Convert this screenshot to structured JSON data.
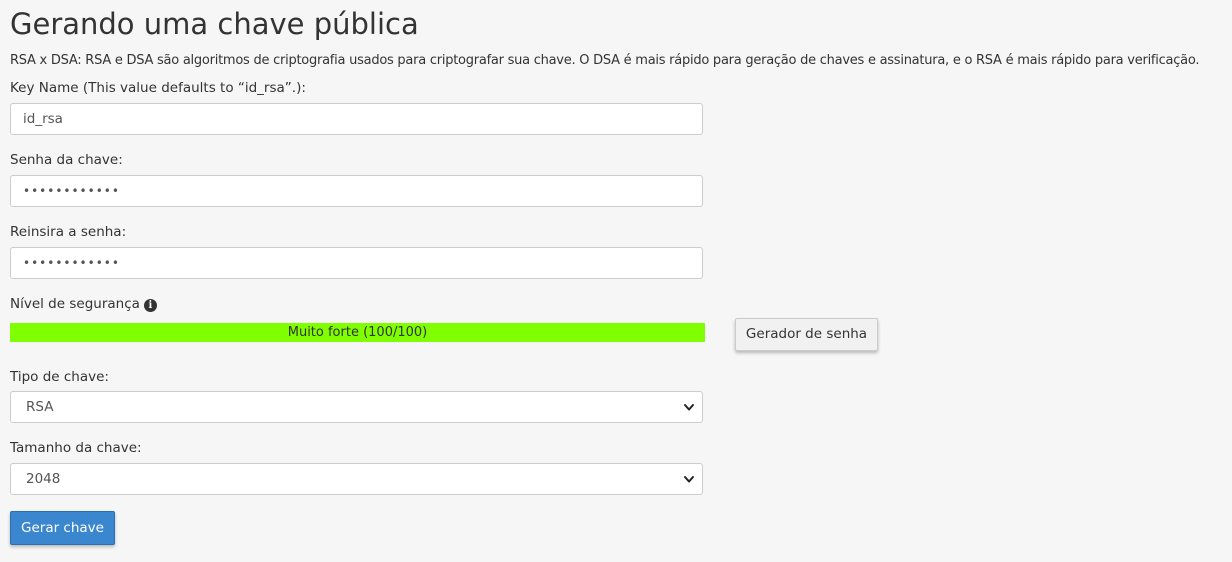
{
  "page": {
    "title": "Gerando uma chave pública",
    "description": "RSA x DSA: RSA e DSA são algoritmos de criptografia usados para criptografar sua chave. O DSA é mais rápido para geração de chaves e assinatura, e o RSA é mais rápido para verificação."
  },
  "form": {
    "key_name": {
      "label": "Key Name (This value defaults to “id_rsa”.):",
      "value": "id_rsa"
    },
    "password": {
      "label": "Senha da chave:",
      "value": "••••••••••••"
    },
    "password_confirm": {
      "label": "Reinsira a senha:",
      "value": "••••••••••••"
    },
    "strength": {
      "label": "Nível de segurança",
      "text": "Muito forte (100/100)",
      "level_percent": 100,
      "fill_color": "#80ff00",
      "info_icon": "info-circle-icon"
    },
    "password_generator_label": "Gerador de senha",
    "key_type": {
      "label": "Tipo de chave:",
      "selected": "RSA"
    },
    "key_size": {
      "label": "Tamanho da chave:",
      "selected": "2048"
    },
    "submit_label": "Gerar chave"
  },
  "colors": {
    "background": "#f6f6f6",
    "primary_button": "#3a87cf",
    "strength_fill": "#80ff00"
  }
}
